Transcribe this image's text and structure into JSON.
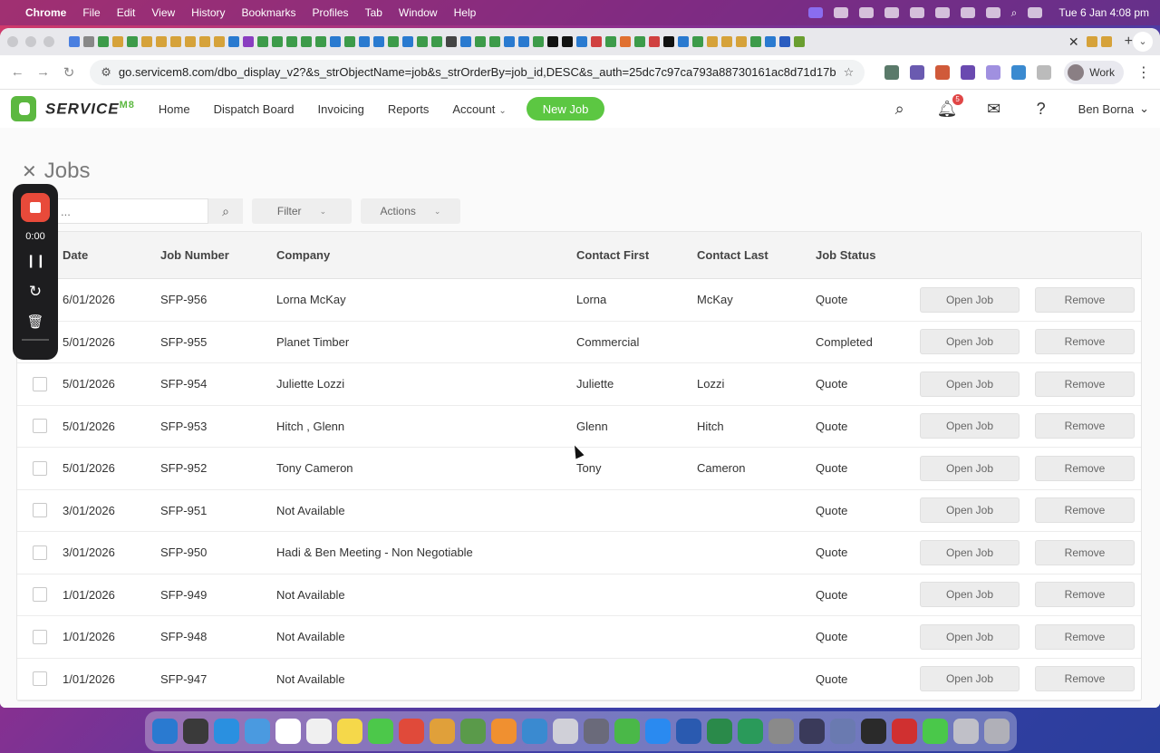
{
  "menubar": {
    "app": "Chrome",
    "items": [
      "File",
      "Edit",
      "View",
      "History",
      "Bookmarks",
      "Profiles",
      "Tab",
      "Window",
      "Help"
    ],
    "clock": "Tue 6 Jan  4:08 pm"
  },
  "browser": {
    "url": "go.servicem8.com/dbo_display_v2?&s_strObjectName=job&s_strOrderBy=job_id,DESC&s_auth=25dc7c97ca793a88730161ac8d71d17b",
    "profile": "Work"
  },
  "app": {
    "logo_text": "SERVICE",
    "logo_suffix": "M8",
    "nav": [
      "Home",
      "Dispatch Board",
      "Invoicing",
      "Reports",
      "Account"
    ],
    "new_job_label": "New Job",
    "notification_count": "5",
    "user_name": "Ben Borna"
  },
  "page": {
    "title": "Jobs",
    "search_placeholder": "...",
    "filter_label": "Filter",
    "actions_label": "Actions"
  },
  "recorder": {
    "time": "0:00"
  },
  "table": {
    "headers": {
      "date": "Date",
      "job_number": "Job Number",
      "company": "Company",
      "contact_first": "Contact First",
      "contact_last": "Contact Last",
      "job_status": "Job Status"
    },
    "open_label": "Open Job",
    "remove_label": "Remove",
    "rows": [
      {
        "date": "6/01/2026",
        "job_number": "SFP-956",
        "company": "Lorna McKay",
        "first": "Lorna",
        "last": "McKay",
        "status": "Quote"
      },
      {
        "date": "5/01/2026",
        "job_number": "SFP-955",
        "company": "Planet Timber",
        "first": "Commercial",
        "last": "",
        "status": "Completed"
      },
      {
        "date": "5/01/2026",
        "job_number": "SFP-954",
        "company": "Juliette Lozzi",
        "first": "Juliette",
        "last": "Lozzi",
        "status": "Quote"
      },
      {
        "date": "5/01/2026",
        "job_number": "SFP-953",
        "company": "Hitch , Glenn",
        "first": "Glenn",
        "last": "Hitch",
        "status": "Quote"
      },
      {
        "date": "5/01/2026",
        "job_number": "SFP-952",
        "company": "Tony Cameron",
        "first": "Tony",
        "last": "Cameron",
        "status": "Quote"
      },
      {
        "date": "3/01/2026",
        "job_number": "SFP-951",
        "company": "Not Available",
        "first": "",
        "last": "",
        "status": "Quote"
      },
      {
        "date": "3/01/2026",
        "job_number": "SFP-950",
        "company": "Hadi & Ben Meeting - Non Negotiable",
        "first": "",
        "last": "",
        "status": "Quote"
      },
      {
        "date": "1/01/2026",
        "job_number": "SFP-949",
        "company": "Not Available",
        "first": "",
        "last": "",
        "status": "Quote"
      },
      {
        "date": "1/01/2026",
        "job_number": "SFP-948",
        "company": "Not Available",
        "first": "",
        "last": "",
        "status": "Quote"
      },
      {
        "date": "1/01/2026",
        "job_number": "SFP-947",
        "company": "Not Available",
        "first": "",
        "last": "",
        "status": "Quote"
      }
    ]
  },
  "colors": {
    "brand_green": "#5cc742",
    "badge_red": "#e04646",
    "record_red": "#e84a3a"
  }
}
